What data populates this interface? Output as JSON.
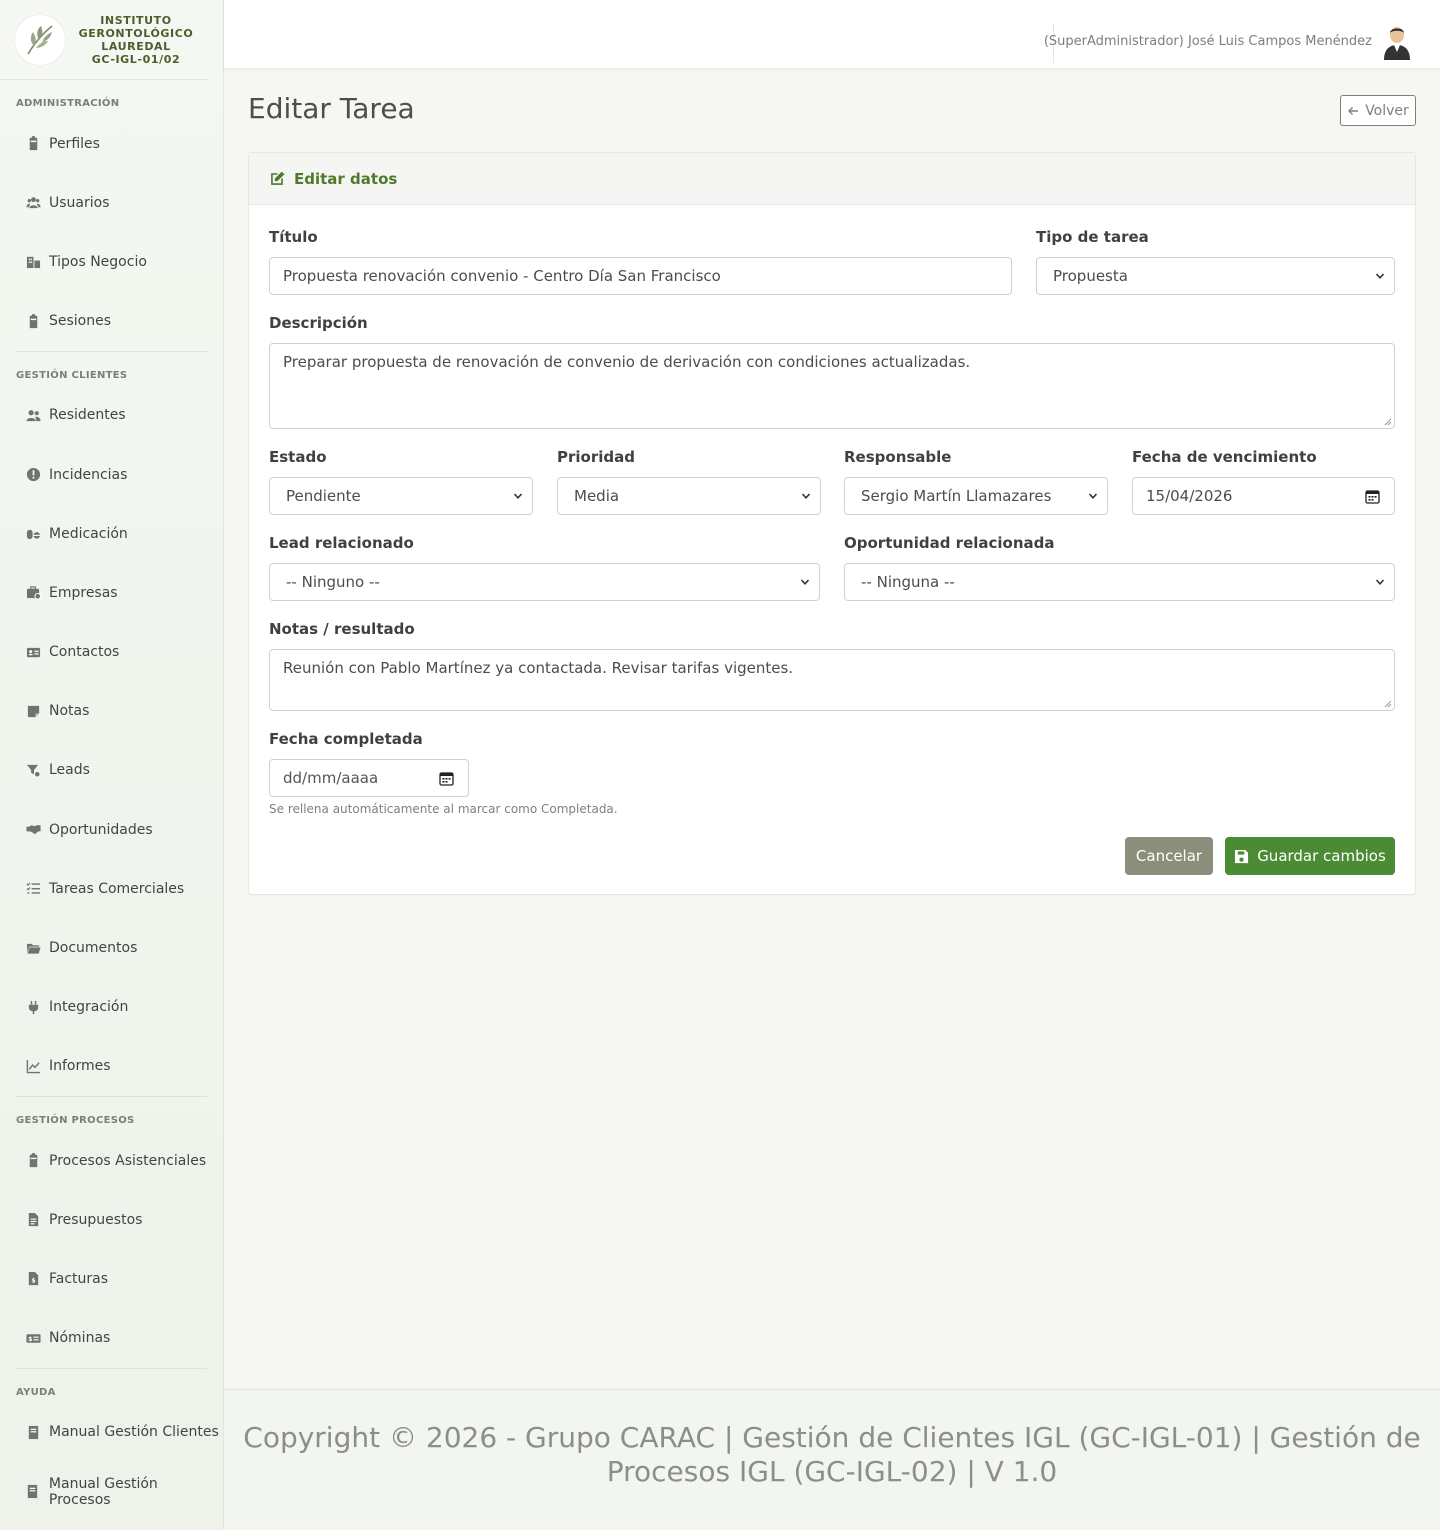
{
  "brand": {
    "line1": "INSTITUTO",
    "line2": "GERONTOLÓGICO",
    "line3": "LAUREDAL",
    "line4": "GC-IGL-01/02"
  },
  "sidebar": {
    "sections": [
      {
        "title": "ADMINISTRACIÓN",
        "items": [
          {
            "label": "Perfiles",
            "icon": "clipboard-icon"
          },
          {
            "label": "Usuarios",
            "icon": "users-icon"
          },
          {
            "label": "Tipos Negocio",
            "icon": "business-icon"
          },
          {
            "label": "Sesiones",
            "icon": "clipboard-icon"
          }
        ]
      },
      {
        "title": "GESTIÓN CLIENTES",
        "items": [
          {
            "label": "Residentes",
            "icon": "user-group-icon"
          },
          {
            "label": "Incidencias",
            "icon": "alert-icon"
          },
          {
            "label": "Medicación",
            "icon": "pills-icon"
          },
          {
            "label": "Empresas",
            "icon": "briefcase-icon"
          },
          {
            "label": "Contactos",
            "icon": "id-card-icon"
          },
          {
            "label": "Notas",
            "icon": "note-icon"
          },
          {
            "label": "Leads",
            "icon": "funnel-icon"
          },
          {
            "label": "Oportunidades",
            "icon": "handshake-icon"
          },
          {
            "label": "Tareas Comerciales",
            "icon": "tasks-icon"
          },
          {
            "label": "Documentos",
            "icon": "folder-icon"
          },
          {
            "label": "Integración",
            "icon": "plug-icon"
          },
          {
            "label": "Informes",
            "icon": "chart-icon"
          }
        ]
      },
      {
        "title": "GESTIÓN PROCESOS",
        "items": [
          {
            "label": "Procesos Asistenciales",
            "icon": "clipboard-icon"
          },
          {
            "label": "Presupuestos",
            "icon": "document-icon"
          },
          {
            "label": "Facturas",
            "icon": "invoice-icon"
          },
          {
            "label": "Nóminas",
            "icon": "money-icon"
          }
        ]
      },
      {
        "title": "AYUDA",
        "items": [
          {
            "label": "Manual Gestión Clientes",
            "icon": "book-icon"
          },
          {
            "label": "Manual Gestión Procesos",
            "icon": "book-icon"
          }
        ]
      }
    ]
  },
  "topbar": {
    "user": "(SuperAdministrador) José Luis Campos Menéndez"
  },
  "page": {
    "title": "Editar Tarea",
    "back_label": "Volver"
  },
  "form": {
    "header": "Editar datos",
    "titulo_label": "Título",
    "titulo_value": "Propuesta renovación convenio - Centro Día San Francisco",
    "tipo_label": "Tipo de tarea",
    "tipo_value": "Propuesta",
    "descripcion_label": "Descripción",
    "descripcion_value": "Preparar propuesta de renovación de convenio de derivación con condiciones actualizadas.",
    "estado_label": "Estado",
    "estado_value": "Pendiente",
    "prioridad_label": "Prioridad",
    "prioridad_value": "Media",
    "responsable_label": "Responsable",
    "responsable_value": "Sergio Martín Llamazares",
    "vencimiento_label": "Fecha de vencimiento",
    "vencimiento_value": "15/04/2026",
    "lead_label": "Lead relacionado",
    "lead_value": "-- Ninguno --",
    "oportunidad_label": "Oportunidad relacionada",
    "oportunidad_value": "-- Ninguna --",
    "notas_label": "Notas / resultado",
    "notas_value": "Reunión con Pablo Martínez ya contactada. Revisar tarifas vigentes.",
    "completada_label": "Fecha completada",
    "completada_placeholder": "dd/mm/aaaa",
    "completada_help": "Se rellena automáticamente al marcar como Completada.",
    "cancel_label": "Cancelar",
    "save_label": "Guardar cambios"
  },
  "footer": {
    "line1": "Copyright © 2026 - Grupo CARAC | Gestión de Clientes IGL (GC-IGL-01) | Gestión de",
    "line2": "Procesos IGL (GC-IGL-02) | V 1.0"
  },
  "colors": {
    "accent": "#4e7a2c",
    "save": "#4a8b34",
    "cancel": "#8a8e7a"
  }
}
